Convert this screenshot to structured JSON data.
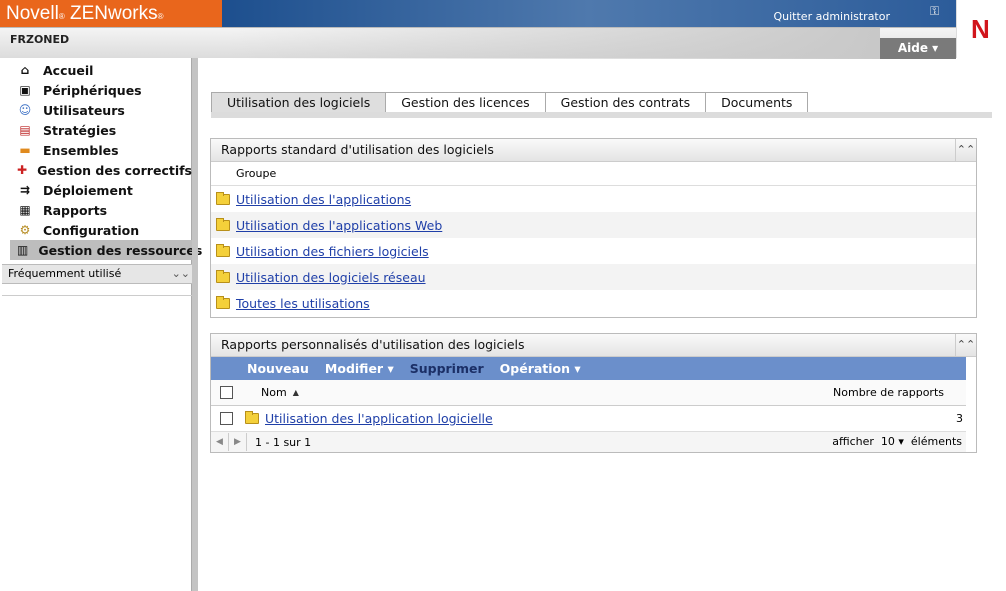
{
  "header": {
    "brand": "Novell",
    "brand_reg": "®",
    "product": "ZENworks",
    "product_reg": "®",
    "logout": "Quitter administrator",
    "zone": "FRZONED",
    "help": "Aide ▾",
    "logo_letter": "N",
    "brand_color": "#e9661c"
  },
  "sidebar": {
    "items": [
      {
        "label": "Accueil",
        "icon": "home-icon"
      },
      {
        "label": "Périphériques",
        "icon": "monitor-icon"
      },
      {
        "label": "Utilisateurs",
        "icon": "user-icon"
      },
      {
        "label": "Stratégies",
        "icon": "policy-icon"
      },
      {
        "label": "Ensembles",
        "icon": "bundle-icon"
      },
      {
        "label": "Gestion des correctifs",
        "icon": "patch-icon"
      },
      {
        "label": "Déploiement",
        "icon": "deploy-icon"
      },
      {
        "label": "Rapports",
        "icon": "report-icon"
      },
      {
        "label": "Configuration",
        "icon": "gear-icon"
      },
      {
        "label": "Gestion des ressources",
        "icon": "asset-icon"
      }
    ],
    "frequent": "Fréquemment utilisé"
  },
  "tabs": [
    "Utilisation des logiciels",
    "Gestion des licences",
    "Gestion des contrats",
    "Documents"
  ],
  "standard_panel": {
    "title": "Rapports standard d'utilisation des logiciels",
    "column": "Groupe",
    "rows": [
      "Utilisation des l'applications",
      "Utilisation des l'applications Web",
      "Utilisation des fichiers logiciels",
      "Utilisation des logiciels réseau",
      "Toutes les utilisations"
    ]
  },
  "custom_panel": {
    "title": "Rapports personnalisés d'utilisation des logiciels",
    "toolbar": {
      "new": "Nouveau",
      "edit": "Modifier ▾",
      "delete": "Supprimer",
      "action": "Opération ▾"
    },
    "col_name": "Nom",
    "col_count": "Nombre de rapports",
    "row_name": "Utilisation des l'application logicielle",
    "row_count": "3",
    "pager": {
      "info": "1 - 1 sur 1",
      "show": "afficher",
      "size": "10 ▾",
      "items": "éléments"
    }
  }
}
